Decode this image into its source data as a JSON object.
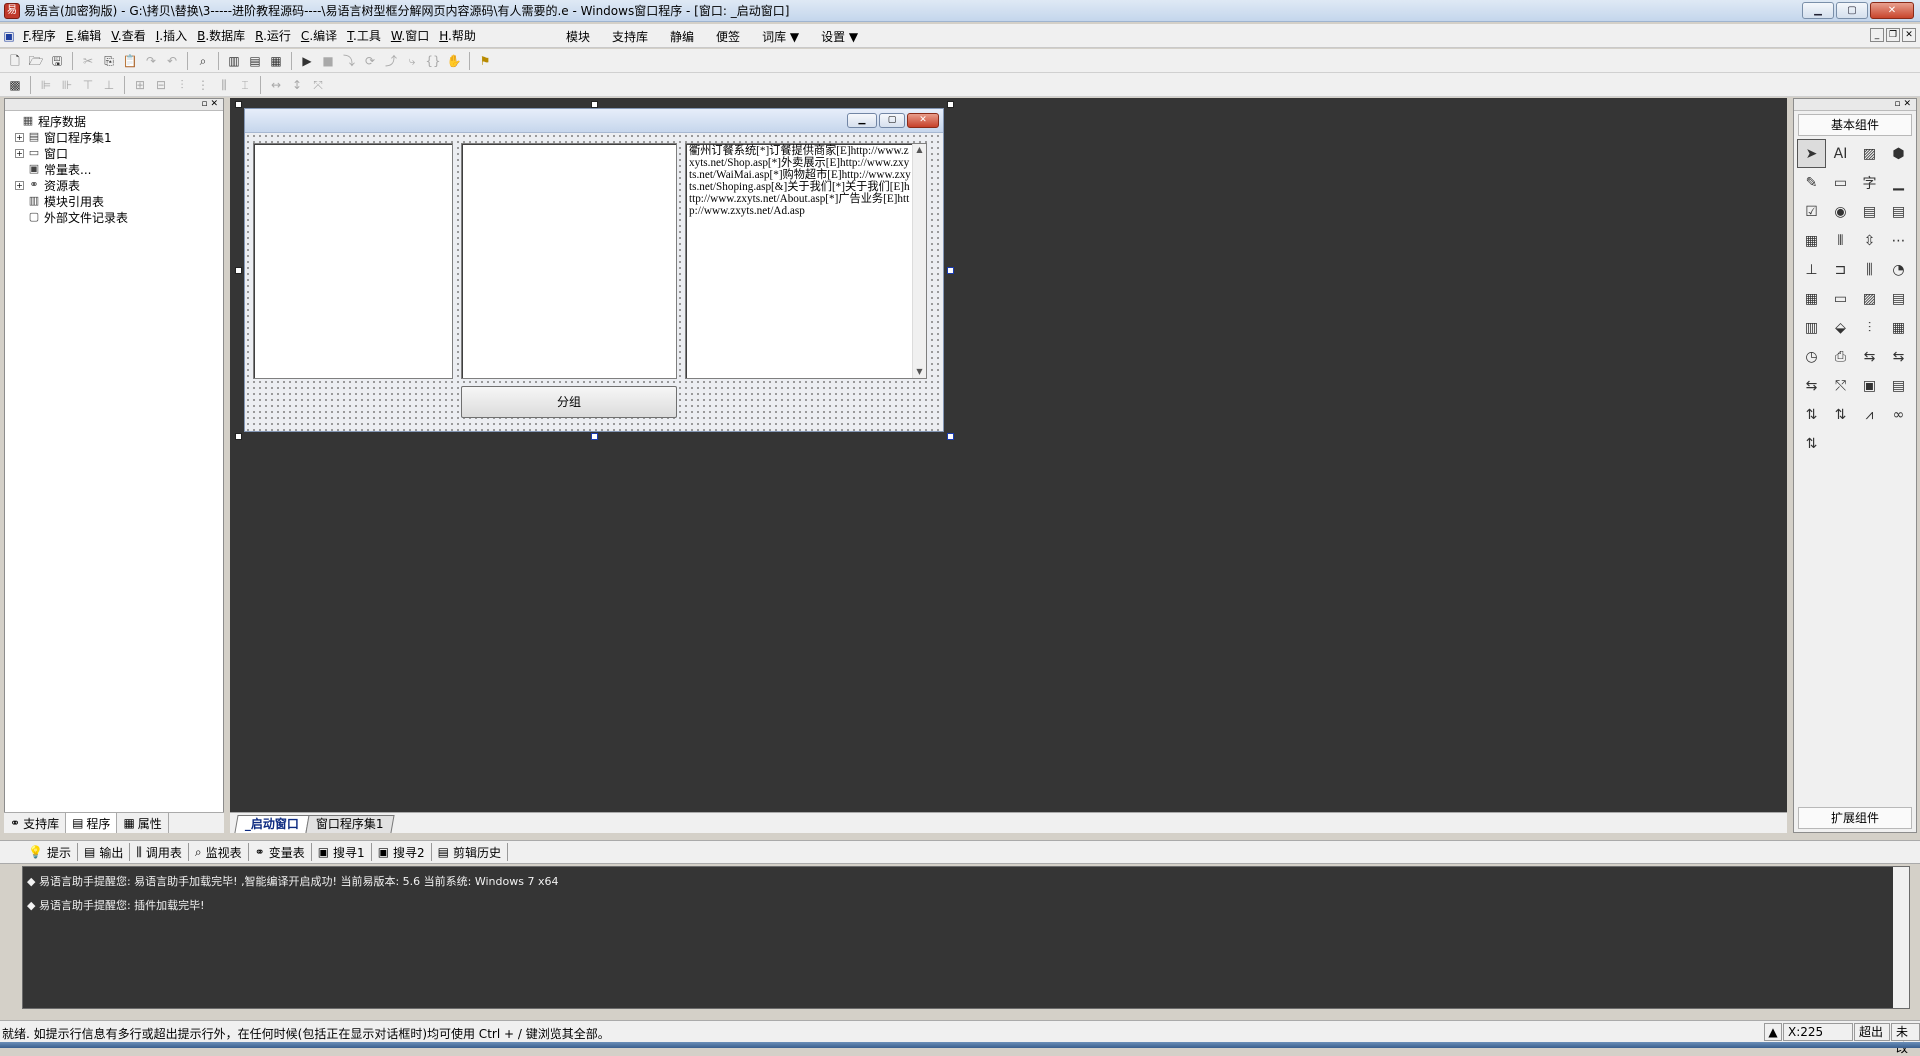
{
  "window": {
    "title": "易语言(加密狗版) - G:\\拷贝\\替换\\3-----进阶教程源码----\\易语言树型框分解网页内容源码\\有人需要的.e - Windows窗口程序 - [窗口: _启动窗口]",
    "minimize": "▁",
    "maximize": "▢",
    "close": "✕"
  },
  "menu": {
    "items": [
      {
        "key": "F",
        "label": ".程序"
      },
      {
        "key": "E",
        "label": ".编辑"
      },
      {
        "key": "V",
        "label": ".查看"
      },
      {
        "key": "I",
        "label": ".插入"
      },
      {
        "key": "B",
        "label": ".数据库"
      },
      {
        "key": "R",
        "label": ".运行"
      },
      {
        "key": "C",
        "label": ".编译"
      },
      {
        "key": "T",
        "label": ".工具"
      },
      {
        "key": "W",
        "label": ".窗口"
      },
      {
        "key": "H",
        "label": ".帮助"
      }
    ],
    "right_items": [
      "模块",
      "支持库",
      "静编",
      "便签",
      "词库 ▼",
      "设置 ▼"
    ]
  },
  "left_panel": {
    "tree": [
      {
        "label": "程序数据",
        "exp": "",
        "icon": "▦",
        "indent": 0
      },
      {
        "label": "窗口程序集1",
        "exp": "+",
        "icon": "▤",
        "indent": 1
      },
      {
        "label": "窗口",
        "exp": "+",
        "icon": "▭",
        "indent": 1
      },
      {
        "label": "常量表...",
        "exp": "",
        "icon": "▣",
        "indent": 1
      },
      {
        "label": "资源表",
        "exp": "+",
        "icon": "⚭",
        "indent": 1
      },
      {
        "label": "模块引用表",
        "exp": "",
        "icon": "▥",
        "indent": 1
      },
      {
        "label": "外部文件记录表",
        "exp": "",
        "icon": "▢",
        "indent": 1
      }
    ],
    "tabs": [
      "支持库",
      "程序",
      "属性"
    ]
  },
  "designer": {
    "edit_text": "衢州订餐系统[*]订餐提供商家[E]http://www.zxyts.net/Shop.asp[*]外卖展示[E]http://www.zxyts.net/WaiMai.asp[*]购物超市[E]http://www.zxyts.net/Shoping.asp[&]关于我们[*]关于我们[E]http://www.zxyts.net/About.asp[*]广告业务[E]http://www.zxyts.net/Ad.asp",
    "button_label": "分组",
    "scroll_up": "▲",
    "scroll_down": "▼"
  },
  "doc_tabs": [
    "_启动窗口",
    "窗口程序集1"
  ],
  "components": {
    "header": "基本组件",
    "footer": "扩展组件",
    "icons": [
      "➤",
      "AI",
      "▨",
      "⬢",
      "✎",
      "▭",
      "字",
      "▁",
      "☑",
      "◉",
      "▤",
      "▤",
      "▦",
      "⫴",
      "⇳",
      "⋯",
      "⊥",
      "⊐",
      "⫼",
      "◔",
      "▦",
      "▭",
      "▨",
      "▤",
      "▥",
      "⬙",
      "⫶",
      "▦",
      "◷",
      "⎙",
      "⇆",
      "⇆",
      "⇆",
      "⤲",
      "▣",
      "▤",
      "⇅",
      "⇅",
      "⩘",
      "∞",
      "⇅"
    ]
  },
  "bottom_tabs": [
    "提示",
    "输出",
    "调用表",
    "监视表",
    "变量表",
    "搜寻1",
    "搜寻2",
    "剪辑历史"
  ],
  "output_lines": [
    "◆ 易语言助手提醒您: 易语言助手加载完毕! ,智能编译开启成功! 当前易版本: 5.6 当前系统: Windows 7 x64",
    "◆ 易语言助手提醒您: 插件加载完毕!"
  ],
  "status": {
    "text": "就绪. 如提示行信息有多行或超出提示行外，在任何时候(包括正在显示对话框时)均可使用 Ctrl + / 键浏览其全部。",
    "coord": "X:225",
    "mode": "超出",
    "extra": "未改"
  }
}
